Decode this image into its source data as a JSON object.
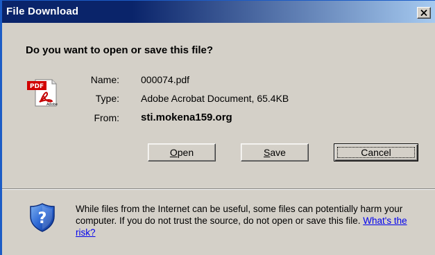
{
  "window": {
    "title": "File Download",
    "close_glyph": "✕"
  },
  "prompt": {
    "question": "Do you want to open or save this file?"
  },
  "file": {
    "icon": "pdf-file-icon",
    "name_label": "Name:",
    "name_value": "000074.pdf",
    "type_label": "Type:",
    "type_value": "Adobe Acrobat Document, 65.4KB",
    "from_label": "From:",
    "from_value": "sti.mokena159.org"
  },
  "buttons": {
    "open_accel": "O",
    "open_rest": "pen",
    "save_accel": "S",
    "save_rest": "ave",
    "cancel": "Cancel"
  },
  "security": {
    "icon": "security-shield-question-icon",
    "warning_text": "While files from the Internet can be useful, some files can potentially harm your computer. If you do not trust the source, do not open or save this file.",
    "risk_link": "What's the risk?"
  },
  "colors": {
    "titlebar_start": "#0a246a",
    "titlebar_end": "#a6caf0",
    "dialog_bg": "#d4d0c8",
    "link": "#0000ee"
  }
}
